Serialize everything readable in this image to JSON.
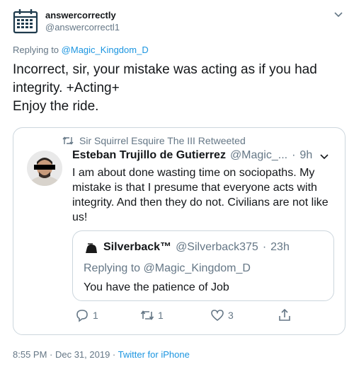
{
  "author": {
    "name": "answercorrectly",
    "handle": "@answercorrectl1"
  },
  "reply_prefix": "Replying to",
  "reply_to": "@Magic_Kingdom_D",
  "tweet_text": "Incorrect, sir, your mistake was acting as if you had integrity. +Acting+\nEnjoy the ride.",
  "quoted": {
    "retweeted_by": "Sir Squirrel Esquire The III Retweeted",
    "name": "Esteban Trujillo de Gutierrez",
    "handle": "@Magic_...",
    "sep": "·",
    "time": "9h",
    "text": "I am about done wasting time on sociopaths. My mistake is that I presume that everyone acts with integrity. And then they do not. Civilians are not like us!",
    "inner": {
      "name": "Silverback™",
      "handle": "@Silverback375",
      "sep": "·",
      "time": "23h",
      "replying": "Replying to @Magic_Kingdom_D",
      "text": "You have the patience of Job"
    },
    "actions": {
      "replies": "1",
      "retweets": "1",
      "likes": "3"
    }
  },
  "footer": {
    "time": "8:55 PM · Dec 31, 2019 ·",
    "source": "Twitter for iPhone"
  },
  "colors": {
    "link": "#1b95e0",
    "muted": "#657786",
    "text": "#14171a",
    "border": "#ccd6dd"
  }
}
